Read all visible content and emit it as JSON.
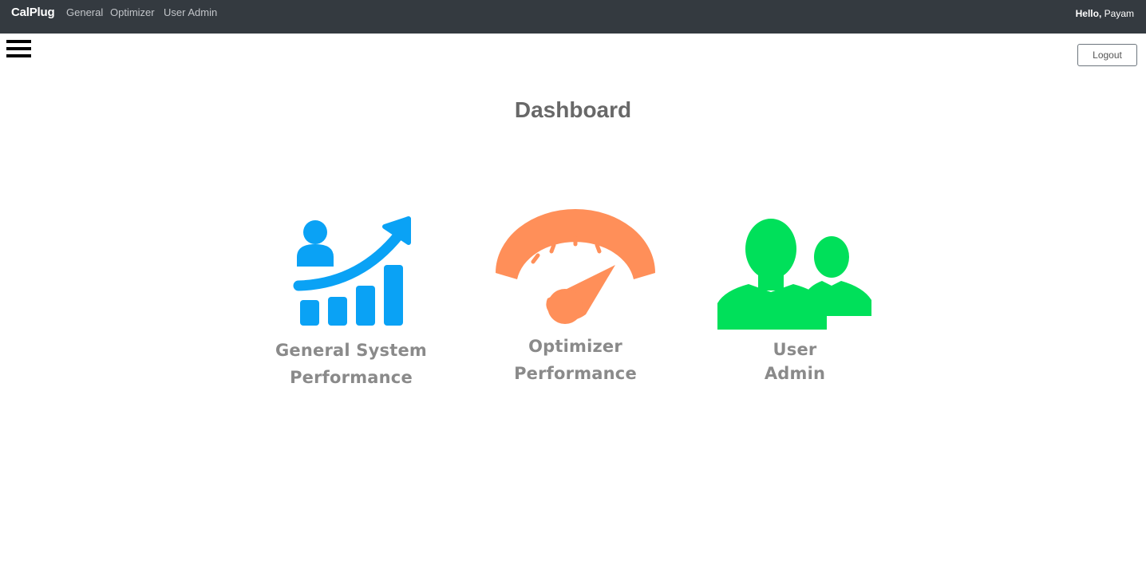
{
  "navbar": {
    "brand": "CalPlug",
    "links": [
      "General",
      "Optimizer",
      "User Admin"
    ],
    "greeting_hello": "Hello,",
    "greeting_name": "Payam"
  },
  "header": {
    "menu_icon": "hamburger-icon",
    "logout_label": "Logout"
  },
  "main": {
    "title": "Dashboard",
    "tiles": [
      {
        "icon": "growth-chart-icon",
        "color": "#0aa2f5",
        "line1": "General System",
        "line2": "Performance"
      },
      {
        "icon": "speedometer-icon",
        "color": "#ff8f59",
        "line1": "Optimizer",
        "line2": "Performance"
      },
      {
        "icon": "users-icon",
        "color": "#00e05a",
        "line1": "User",
        "line2": "Admin"
      }
    ]
  }
}
